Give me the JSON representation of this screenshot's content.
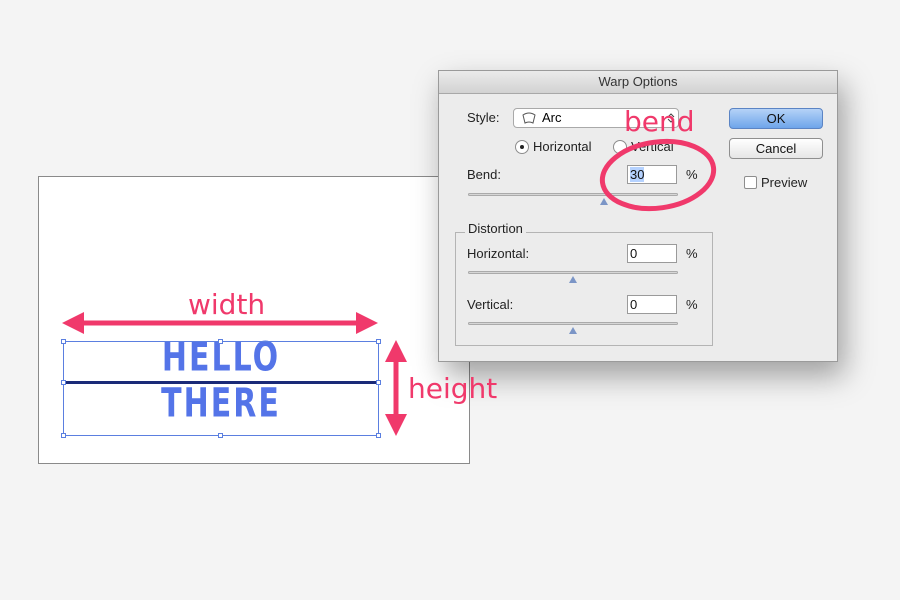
{
  "annotations": {
    "width_label": "width",
    "height_label": "height",
    "bend_label": "bend",
    "color": "#f0396b"
  },
  "canvas": {
    "line1": "HELLO",
    "line2": "THERE",
    "text_color": "#5474e8",
    "selection_color": "#5b7fe0"
  },
  "dialog": {
    "title": "Warp Options",
    "style_label": "Style:",
    "style_value": "Arc",
    "style_icon": "arc-warp-icon",
    "orientation": {
      "horizontal_label": "Horizontal",
      "vertical_label": "Vertical",
      "selected": "Horizontal"
    },
    "bend": {
      "label": "Bend:",
      "value": "30",
      "unit": "%",
      "slider_level_percent": 30
    },
    "distortion": {
      "title": "Distortion",
      "horizontal": {
        "label": "Horizontal:",
        "value": "0",
        "unit": "%",
        "slider_level_percent": 0
      },
      "vertical": {
        "label": "Vertical:",
        "value": "0",
        "unit": "%",
        "slider_level_percent": 0
      }
    },
    "buttons": {
      "ok": "OK",
      "cancel": "Cancel"
    },
    "preview": {
      "label": "Preview",
      "checked": false
    }
  }
}
